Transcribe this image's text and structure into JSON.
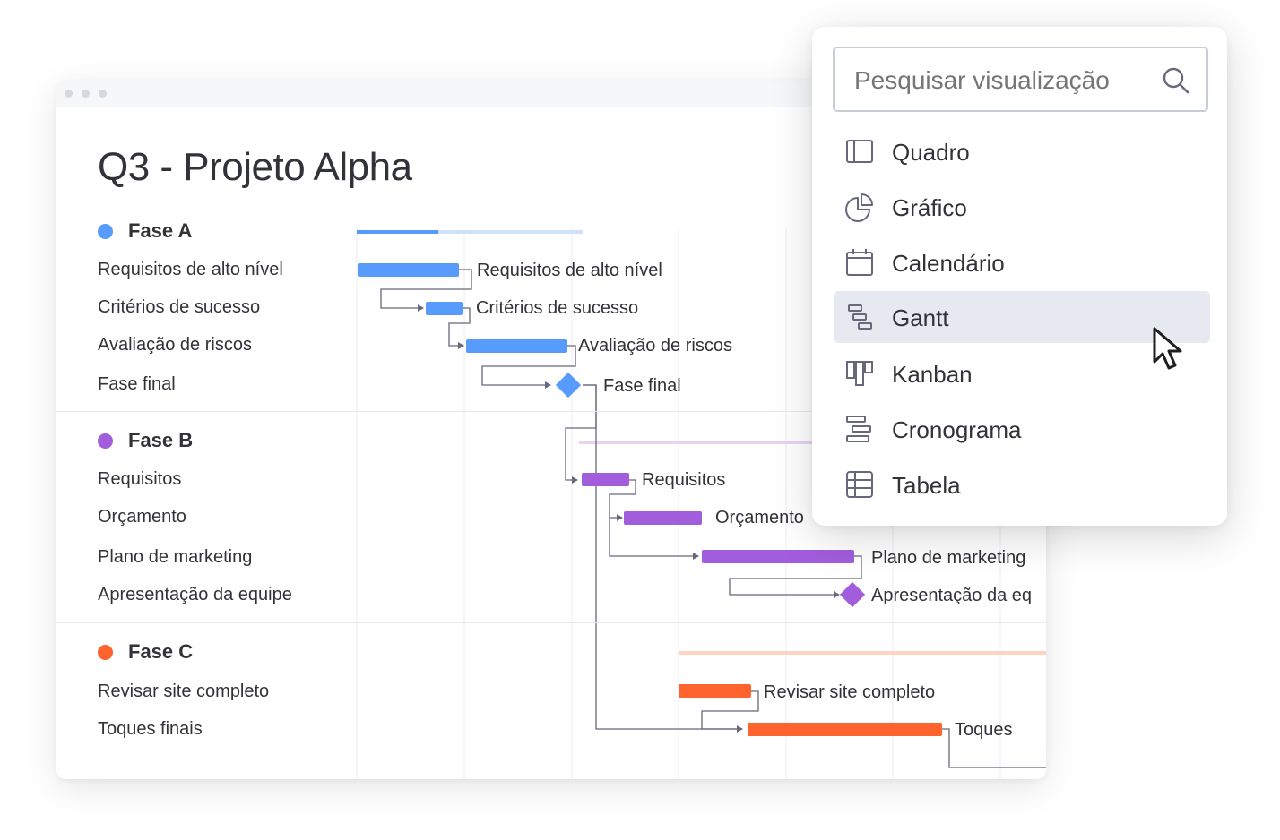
{
  "project": {
    "title": "Q3 - Projeto Alpha",
    "phases": [
      {
        "name": "Fase A",
        "color": "#579bfc",
        "tasks": [
          {
            "label": "Requisitos de alto nível",
            "bar_label": "Requisitos de alto nível"
          },
          {
            "label": "Critérios de sucesso",
            "bar_label": "Critérios de sucesso"
          },
          {
            "label": "Avaliação de riscos",
            "bar_label": "Avaliação de riscos"
          },
          {
            "label": "Fase final",
            "bar_label": "Fase final"
          }
        ]
      },
      {
        "name": "Fase B",
        "color": "#a25ddc",
        "tasks": [
          {
            "label": "Requisitos",
            "bar_label": "Requisitos"
          },
          {
            "label": "Orçamento",
            "bar_label": "Orçamento"
          },
          {
            "label": "Plano de marketing",
            "bar_label": "Plano de marketing"
          },
          {
            "label": "Apresentação da equipe",
            "bar_label": "Apresentação da eq"
          }
        ]
      },
      {
        "name": "Fase C",
        "color": "#ff642e",
        "tasks": [
          {
            "label": "Revisar site completo",
            "bar_label": "Revisar site completo"
          },
          {
            "label": "Toques finais",
            "bar_label": "Toques"
          }
        ]
      }
    ]
  },
  "view_menu": {
    "search_placeholder": "Pesquisar visualização",
    "items": [
      {
        "label": "Quadro",
        "icon": "board-icon"
      },
      {
        "label": "Gráfico",
        "icon": "chart-icon"
      },
      {
        "label": "Calendário",
        "icon": "calendar-icon"
      },
      {
        "label": "Gantt",
        "icon": "gantt-icon",
        "selected": true
      },
      {
        "label": "Kanban",
        "icon": "kanban-icon"
      },
      {
        "label": "Cronograma",
        "icon": "timeline-icon"
      },
      {
        "label": "Tabela",
        "icon": "table-icon"
      }
    ]
  }
}
